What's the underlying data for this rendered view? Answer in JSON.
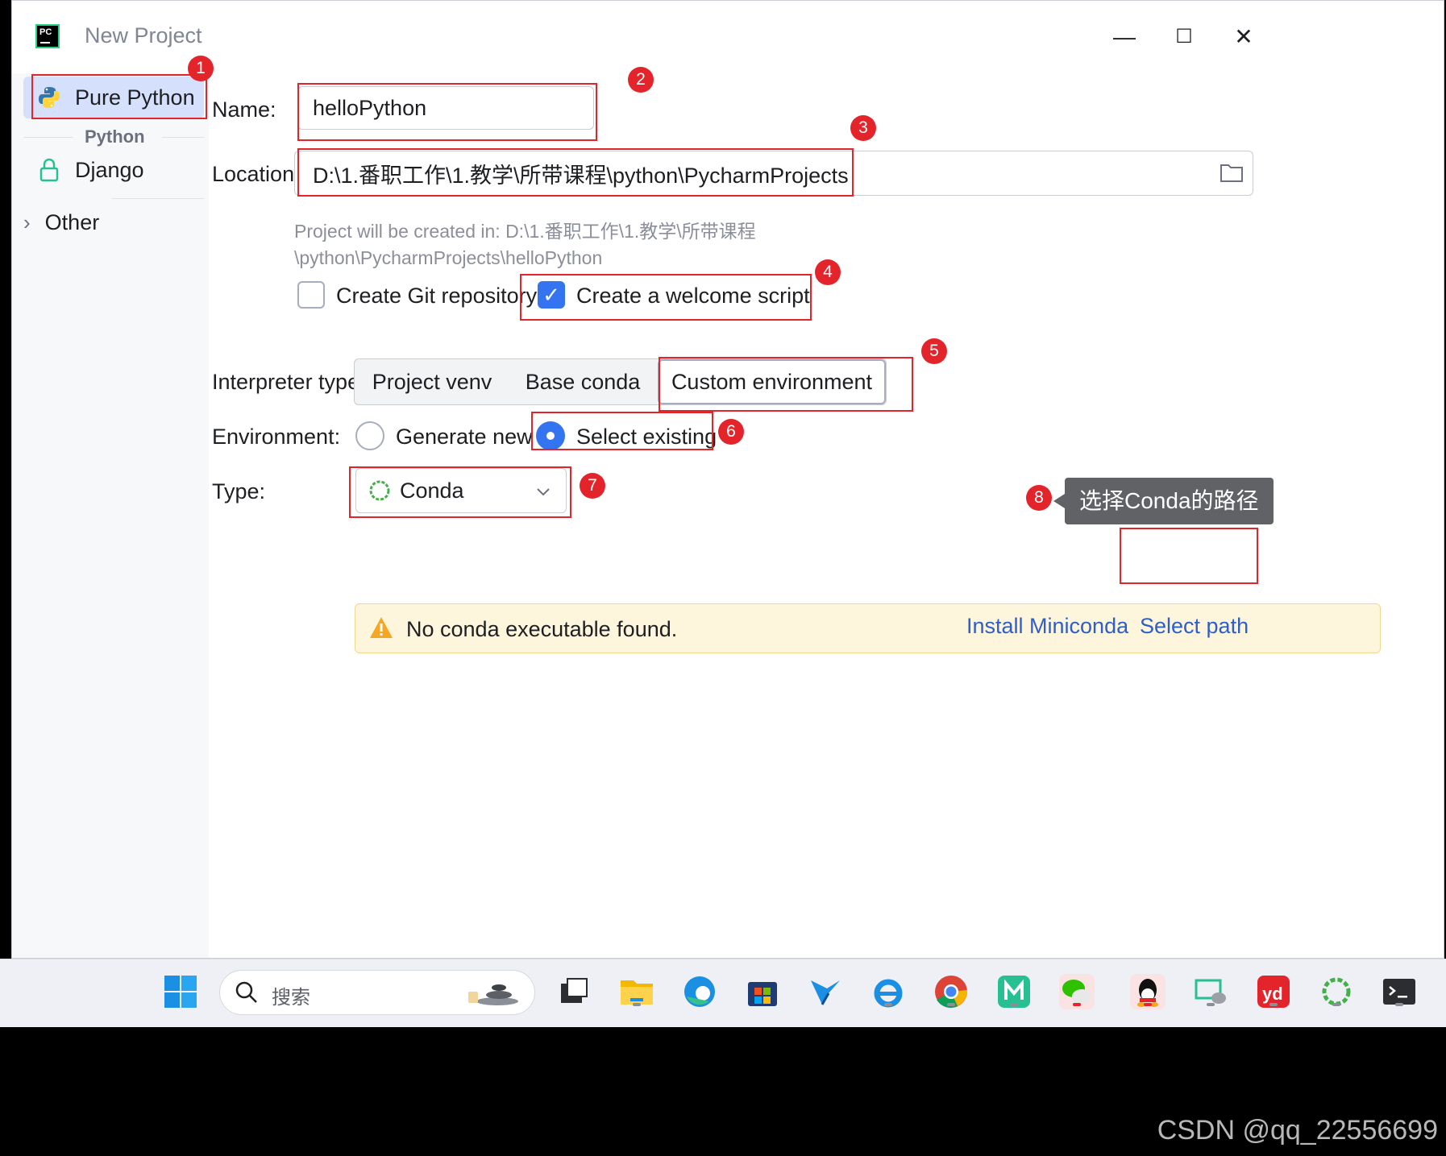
{
  "window": {
    "title": "New Project",
    "logo_text": "PC",
    "controls": {
      "minimize": "—",
      "maximize": "☐",
      "close": "✕"
    }
  },
  "sidebar": {
    "items": [
      {
        "label": "Pure Python",
        "icon": "python-icon",
        "selected": true
      },
      {
        "label": "Django",
        "icon": "django-lock-icon",
        "selected": false
      }
    ],
    "group_label": "Python",
    "other_label": "Other"
  },
  "form": {
    "name_label": "Name:",
    "name_value": "helloPython",
    "location_label": "Location:",
    "location_value": "D:\\1.番职工作\\1.教学\\所带课程\\python\\PycharmProjects",
    "hint_line1": "Project will be created in: D:\\1.番职工作\\1.教学\\所带课程",
    "hint_line2": "\\python\\PycharmProjects\\helloPython",
    "git_label": "Create Git repository",
    "git_checked": false,
    "welcome_label": "Create a welcome script",
    "welcome_checked": true,
    "interpreter_label": "Interpreter type:",
    "interpreter_options": [
      "Project venv",
      "Base conda",
      "Custom environment"
    ],
    "interpreter_selected": "Custom environment",
    "environment_label": "Environment:",
    "env_options": [
      "Generate new",
      "Select existing"
    ],
    "env_selected": "Select existing",
    "type_label": "Type:",
    "type_value": "Conda",
    "warning_text": "No conda executable found.",
    "install_link": "Install Miniconda",
    "select_path_link": "Select path"
  },
  "annotations": {
    "badges": [
      "1",
      "2",
      "3",
      "4",
      "5",
      "6",
      "7",
      "8"
    ],
    "tooltip": "选择Conda的路径",
    "color": "#e3242b"
  },
  "taskbar": {
    "search_placeholder": "搜索",
    "apps": [
      "windows-start-icon",
      "task-view-icon",
      "file-explorer-icon",
      "edge-icon",
      "store-icon",
      "vscode-like-icon",
      "ie-icon",
      "chrome-icon",
      "miro-icon",
      "wechat-icon",
      "qq-icon",
      "remote-icon",
      "youdao-icon",
      "pycharm-conda-icon",
      "terminal-icon"
    ]
  },
  "watermark": "CSDN @qq_22556699",
  "colors": {
    "accent": "#3574f0",
    "link": "#2e5ec9",
    "warning_bg": "#fdf6dc",
    "annotation": "#e3242b"
  }
}
